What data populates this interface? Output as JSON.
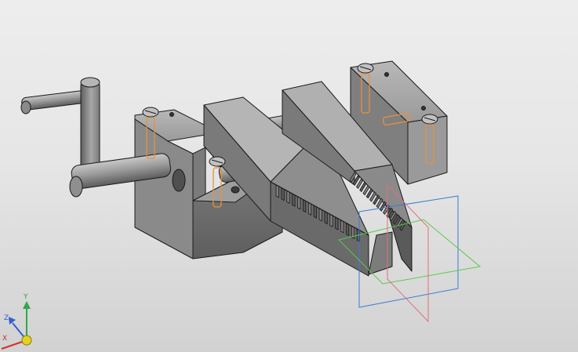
{
  "viewport": {
    "background_top": "#ededed",
    "background_bottom": "#d2d2d2"
  },
  "colors": {
    "body_top": "#a9a9a9",
    "body_front": "#6e6e6e",
    "body_side": "#8c8c8c",
    "edge": "#1a1a1a",
    "pin": "#e8913a",
    "plane_blue": "#3a7bd5",
    "plane_green": "#58c94a",
    "plane_red": "#e0707a",
    "axis_x": "#d03030",
    "axis_y": "#2fa84a",
    "axis_z": "#3060d0",
    "origin": "#e6d21e"
  },
  "triad": {
    "x_label": "X",
    "y_label": "Y",
    "z_label": "Z"
  },
  "model": {
    "parts": [
      "vise-body",
      "handle-crank",
      "sliding-jaw-left",
      "sliding-jaw-right",
      "wedge-rack",
      "guide-rods",
      "locating-pins",
      "slotted-screws"
    ],
    "rack_teeth_count": 16,
    "visible_pins": 4
  }
}
